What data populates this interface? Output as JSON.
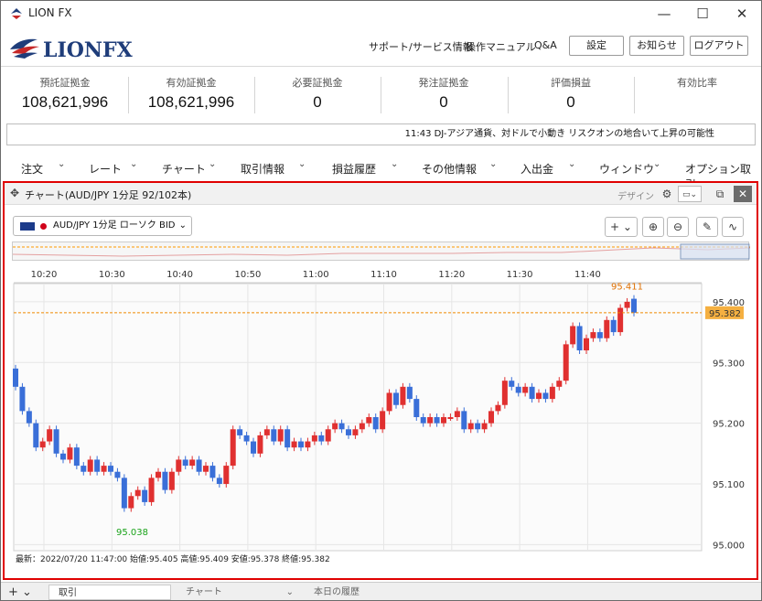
{
  "window": {
    "title": "LION FX",
    "minimize": "—",
    "maximize": "☐",
    "close": "✕"
  },
  "header": {
    "logo_text": "LIONFX",
    "links": [
      "サポート/サービス情報",
      "操作マニュアル",
      "Q&A"
    ],
    "buttons": [
      "設定",
      "お知らせ",
      "ログアウト"
    ]
  },
  "stats": [
    {
      "label": "預託証拠金",
      "value": "108,621,996"
    },
    {
      "label": "有効証拠金",
      "value": "108,621,996"
    },
    {
      "label": "必要証拠金",
      "value": "0"
    },
    {
      "label": "発注証拠金",
      "value": "0"
    },
    {
      "label": "評価損益",
      "value": "0"
    },
    {
      "label": "有効比率",
      "value": ""
    }
  ],
  "news": {
    "text": "11:43 DJ-アジア通貨、対ドルで小動き リスクオンの地合いて上昇の可能性"
  },
  "menu": [
    "注文",
    "レート",
    "チャート",
    "取引情報",
    "損益履歴",
    "その他情報",
    "入出金",
    "ウィンドウ",
    "オプション取引"
  ],
  "panel": {
    "title": "チャート(AUD/JPY 1分足 92/102本)",
    "design": "デザイン",
    "selector": "AUD/JPY 1分足 ローソク BID"
  },
  "chart_data": {
    "type": "candlestick",
    "x_ticks": [
      "10:20",
      "10:30",
      "10:40",
      "10:50",
      "11:00",
      "11:10",
      "11:20",
      "11:30",
      "11:40"
    ],
    "y_ticks": [
      "95.400",
      "95.300",
      "95.200",
      "95.100",
      "95.000"
    ],
    "ylim": [
      94.99,
      95.43
    ],
    "current_price": "95.382",
    "high_label": "95.411",
    "low_label": "95.038",
    "info": "最新：2022/07/20 11:47:00 始値:95.405 高値:95.409 安値:95.378 終値:95.382",
    "candles": [
      [
        95.29,
        95.26
      ],
      [
        95.26,
        95.22
      ],
      [
        95.22,
        95.2
      ],
      [
        95.2,
        95.16
      ],
      [
        95.16,
        95.17
      ],
      [
        95.17,
        95.19
      ],
      [
        95.19,
        95.15
      ],
      [
        95.15,
        95.14
      ],
      [
        95.14,
        95.16
      ],
      [
        95.16,
        95.13
      ],
      [
        95.13,
        95.12
      ],
      [
        95.12,
        95.14
      ],
      [
        95.14,
        95.12
      ],
      [
        95.12,
        95.13
      ],
      [
        95.13,
        95.12
      ],
      [
        95.12,
        95.11
      ],
      [
        95.11,
        95.06
      ],
      [
        95.06,
        95.08
      ],
      [
        95.08,
        95.09
      ],
      [
        95.09,
        95.07
      ],
      [
        95.07,
        95.11
      ],
      [
        95.11,
        95.12
      ],
      [
        95.12,
        95.09
      ],
      [
        95.09,
        95.12
      ],
      [
        95.12,
        95.14
      ],
      [
        95.14,
        95.13
      ],
      [
        95.13,
        95.14
      ],
      [
        95.14,
        95.12
      ],
      [
        95.12,
        95.13
      ],
      [
        95.13,
        95.11
      ],
      [
        95.11,
        95.1
      ],
      [
        95.1,
        95.13
      ],
      [
        95.13,
        95.19
      ],
      [
        95.19,
        95.18
      ],
      [
        95.18,
        95.17
      ],
      [
        95.17,
        95.15
      ],
      [
        95.15,
        95.18
      ],
      [
        95.18,
        95.19
      ],
      [
        95.19,
        95.17
      ],
      [
        95.17,
        95.19
      ],
      [
        95.19,
        95.16
      ],
      [
        95.16,
        95.17
      ],
      [
        95.17,
        95.16
      ],
      [
        95.16,
        95.17
      ],
      [
        95.17,
        95.18
      ],
      [
        95.18,
        95.17
      ],
      [
        95.17,
        95.19
      ],
      [
        95.19,
        95.2
      ],
      [
        95.2,
        95.19
      ],
      [
        95.19,
        95.18
      ],
      [
        95.18,
        95.19
      ],
      [
        95.19,
        95.2
      ],
      [
        95.2,
        95.21
      ],
      [
        95.21,
        95.19
      ],
      [
        95.19,
        95.22
      ],
      [
        95.22,
        95.25
      ],
      [
        95.25,
        95.23
      ],
      [
        95.23,
        95.26
      ],
      [
        95.26,
        95.24
      ],
      [
        95.24,
        95.21
      ],
      [
        95.21,
        95.2
      ],
      [
        95.2,
        95.21
      ],
      [
        95.21,
        95.2
      ],
      [
        95.2,
        95.21
      ],
      [
        95.21,
        95.21
      ],
      [
        95.21,
        95.22
      ],
      [
        95.22,
        95.19
      ],
      [
        95.19,
        95.2
      ],
      [
        95.2,
        95.19
      ],
      [
        95.19,
        95.2
      ],
      [
        95.2,
        95.22
      ],
      [
        95.22,
        95.23
      ],
      [
        95.23,
        95.27
      ],
      [
        95.27,
        95.26
      ],
      [
        95.26,
        95.25
      ],
      [
        95.25,
        95.26
      ],
      [
        95.26,
        95.24
      ],
      [
        95.24,
        95.25
      ],
      [
        95.25,
        95.24
      ],
      [
        95.24,
        95.26
      ],
      [
        95.26,
        95.27
      ],
      [
        95.27,
        95.33
      ],
      [
        95.33,
        95.36
      ],
      [
        95.36,
        95.32
      ],
      [
        95.32,
        95.34
      ],
      [
        95.34,
        95.35
      ],
      [
        95.35,
        95.34
      ],
      [
        95.34,
        95.37
      ],
      [
        95.37,
        95.35
      ],
      [
        95.35,
        95.39
      ],
      [
        95.39,
        95.4
      ],
      [
        95.405,
        95.382
      ]
    ]
  }
}
